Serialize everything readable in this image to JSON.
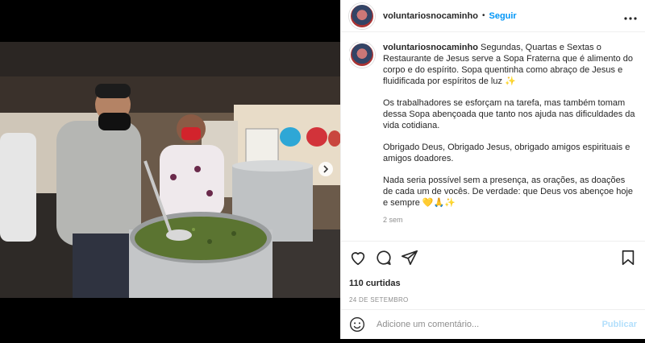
{
  "post": {
    "username": "voluntariosnocaminho",
    "dot": "•",
    "follow_label": "Seguir",
    "more_label": "•••",
    "caption_username": "voluntariosnocaminho",
    "caption_lines": [
      "Segundas, Quartas e Sextas o Restaurante de Jesus serve a Sopa Fraterna que é alimento do corpo e do espírito. Sopa quentinha como abraço de Jesus e fluidificada por espíritos de luz ✨",
      "Os trabalhadores se esforçam na tarefa, mas também tomam dessa Sopa abençoada que tanto nos ajuda nas dificuldades da vida cotidiana.",
      "Obrigado Deus, Obrigado Jesus, obrigado amigos espirituais e amigos doadores.",
      "Nada seria possível sem a presença, as orações, as doações de cada um de vocês. De verdade: que Deus vos abençoe hoje e sempre 💛🙏✨"
    ],
    "time_ago": "2 sem",
    "likes": "110 curtidas",
    "date": "24 DE SETEMBRO",
    "comment_placeholder": "Adicione um comentário...",
    "publish_label": "Publicar"
  },
  "icons": {
    "like": "heart-icon",
    "comment": "comment-icon",
    "share": "share-icon",
    "save": "bookmark-icon",
    "emoji": "emoji-icon",
    "next": "chevron-right-icon"
  },
  "colors": {
    "link_blue": "#0095f6",
    "publish_disabled": "#b2dffc",
    "text": "#262626",
    "muted": "#8e8e8e"
  }
}
